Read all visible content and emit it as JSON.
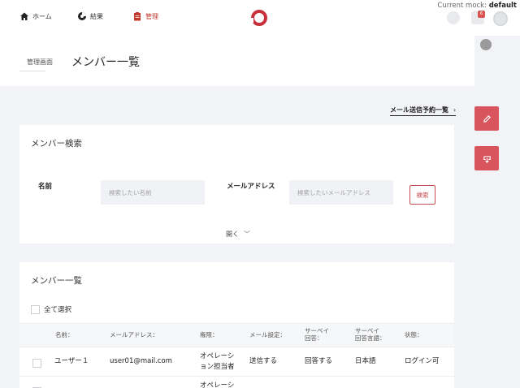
{
  "nav": {
    "home": "ホーム",
    "results": "結果",
    "admin": "管理"
  },
  "mock": {
    "prefix": "Current mock:",
    "value": "default"
  },
  "notification_count": "6",
  "header": {
    "breadcrumb": "管理画面",
    "title": "メンバー一覧"
  },
  "mail_schedule_link": "メール送信予約一覧",
  "search": {
    "title": "メンバー検索",
    "name_label": "名前",
    "name_placeholder": "検索したい名前",
    "email_label": "メールアドレス",
    "email_placeholder": "検索したいメールアドレス",
    "search_button": "検索",
    "expand": "開く"
  },
  "list": {
    "title": "メンバー一覧",
    "select_all": "全て選択",
    "columns": [
      "名前：",
      "メールアドレス：",
      "権限：",
      "メール設定：",
      "サーベイ\n回答：",
      "サーベイ\n回答言語：",
      "状態："
    ],
    "rows": [
      {
        "name": "ユーザー１",
        "email": "user01@mail.com",
        "role": "オペレーション担当者",
        "mail_setting": "送信する",
        "survey_answer": "回答する",
        "survey_lang": "日本語",
        "status": "ログイン可"
      },
      {
        "name": "",
        "email": "",
        "role": "オペレーシ",
        "mail_setting": "",
        "survey_answer": "",
        "survey_lang": "",
        "status": ""
      }
    ]
  },
  "colors": {
    "accent": "#d9555d",
    "admin_nav": "#c0392b",
    "background": "#f2f3f7"
  }
}
